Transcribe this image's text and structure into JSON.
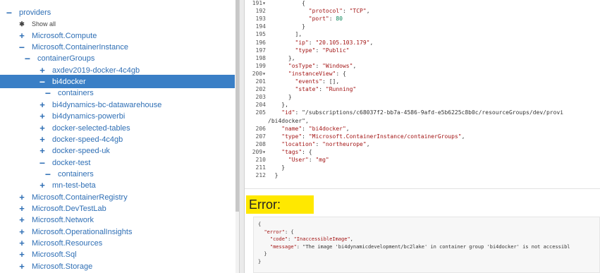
{
  "tree": {
    "items": [
      {
        "label": "providers",
        "marker": "minus",
        "indent": 0
      },
      {
        "label": "Show all",
        "marker": "star",
        "indent": 1
      },
      {
        "label": "Microsoft.Compute",
        "marker": "plus",
        "indent": 1
      },
      {
        "label": "Microsoft.ContainerInstance",
        "marker": "minus",
        "indent": 1
      },
      {
        "label": "containerGroups",
        "marker": "minus",
        "indent": 2
      },
      {
        "label": "axdev2019-docker-4c4gb",
        "marker": "plus",
        "indent": 3
      },
      {
        "label": "bi4docker",
        "marker": "minus",
        "indent": 3,
        "selected": true
      },
      {
        "label": "containers",
        "marker": "minus",
        "indent": 4
      },
      {
        "label": "bi4dynamics-bc-datawarehouse",
        "marker": "plus",
        "indent": 3
      },
      {
        "label": "bi4dynamics-powerbi",
        "marker": "plus",
        "indent": 3
      },
      {
        "label": "docker-selected-tables",
        "marker": "plus",
        "indent": 3
      },
      {
        "label": "docker-speed-4c4gb",
        "marker": "plus",
        "indent": 3
      },
      {
        "label": "docker-speed-uk",
        "marker": "plus",
        "indent": 3
      },
      {
        "label": "docker-test",
        "marker": "minus",
        "indent": 3
      },
      {
        "label": "containers",
        "marker": "minus",
        "indent": 4
      },
      {
        "label": "mn-test-beta",
        "marker": "plus",
        "indent": 3
      },
      {
        "label": "Microsoft.ContainerRegistry",
        "marker": "plus",
        "indent": 1
      },
      {
        "label": "Microsoft.DevTestLab",
        "marker": "plus",
        "indent": 1
      },
      {
        "label": "Microsoft.Network",
        "marker": "plus",
        "indent": 1
      },
      {
        "label": "Microsoft.OperationalInsights",
        "marker": "plus",
        "indent": 1
      },
      {
        "label": "Microsoft.Resources",
        "marker": "plus",
        "indent": 1
      },
      {
        "label": "Microsoft.Sql",
        "marker": "plus",
        "indent": 1
      },
      {
        "label": "Microsoft.Storage",
        "marker": "plus",
        "indent": 1
      }
    ]
  },
  "code": {
    "lines": [
      {
        "num": "191▾",
        "text": "          {"
      },
      {
        "num": "192",
        "text": "            \"protocol\": \"TCP\","
      },
      {
        "num": "193",
        "text": "            \"port\": 80"
      },
      {
        "num": "194",
        "text": "          }"
      },
      {
        "num": "195",
        "text": "        ],"
      },
      {
        "num": "196",
        "text": "        \"ip\": \"20.105.103.179\","
      },
      {
        "num": "197",
        "text": "        \"type\": \"Public\""
      },
      {
        "num": "198",
        "text": "      },"
      },
      {
        "num": "199",
        "text": "      \"osType\": \"Windows\","
      },
      {
        "num": "200▾",
        "text": "      \"instanceView\": {"
      },
      {
        "num": "201",
        "text": "        \"events\": [],"
      },
      {
        "num": "202",
        "text": "        \"state\": \"Running\""
      },
      {
        "num": "203",
        "text": "      }"
      },
      {
        "num": "204",
        "text": "    },"
      },
      {
        "num": "205",
        "text": "    \"id\": \"/subscriptions/c68037f2-bb7a-4586-9afd-e5b6225c8b0c/resourceGroups/dev/provi"
      },
      {
        "num": "",
        "text": "/bi4docker\","
      },
      {
        "num": "206",
        "text": "    \"name\": \"bi4docker\","
      },
      {
        "num": "207",
        "text": "    \"type\": \"Microsoft.ContainerInstance/containerGroups\","
      },
      {
        "num": "208",
        "text": "    \"location\": \"northeurope\","
      },
      {
        "num": "209▾",
        "text": "    \"tags\": {"
      },
      {
        "num": "210",
        "text": "      \"User\": \"mg\""
      },
      {
        "num": "211",
        "text": "    }"
      },
      {
        "num": "212",
        "text": "  }"
      }
    ]
  },
  "error": {
    "heading": "Error:",
    "lines": [
      "{",
      "  \"error\": {",
      "    \"code\": \"InaccessibleImage\",",
      "    \"message\": \"The image 'bi4dynamicdevelopment/bc2lake' in container group 'bi4docker' is not accessibl",
      "  }",
      "}"
    ]
  },
  "colors": {
    "tree_link": "#2f6fb5",
    "selected_bg": "#3a7fc6",
    "error_highlight": "#ffe800",
    "json_string": "#a31515",
    "json_number": "#098658"
  }
}
